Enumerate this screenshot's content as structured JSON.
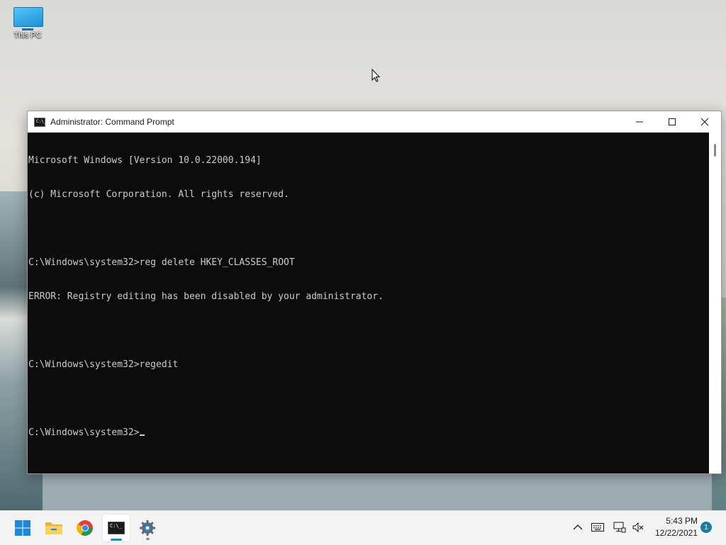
{
  "desktop": {
    "icons": [
      {
        "label": "This PC",
        "icon": "monitor-icon"
      }
    ]
  },
  "window": {
    "title": "Administrator: Command Prompt",
    "icon": "command-prompt-icon",
    "icon_glyph": "C:\\_",
    "controls": [
      "minimize-icon",
      "maximize-icon",
      "close-icon"
    ],
    "console_lines": [
      "Microsoft Windows [Version 10.0.22000.194]",
      "(c) Microsoft Corporation. All rights reserved.",
      "",
      "C:\\Windows\\system32>reg delete HKEY_CLASSES_ROOT",
      "ERROR: Registry editing has been disabled by your administrator.",
      "",
      "C:\\Windows\\system32>regedit",
      "",
      "C:\\Windows\\system32>"
    ],
    "colors": {
      "background": "#0c0c0c",
      "text": "#cccccc"
    }
  },
  "taskbar": {
    "apps": [
      {
        "name": "start",
        "icon": "windows-start-icon"
      },
      {
        "name": "file-explorer",
        "icon": "folder-icon"
      },
      {
        "name": "chrome",
        "icon": "chrome-icon"
      },
      {
        "name": "command-prompt",
        "icon": "terminal-icon",
        "active": true,
        "glyph": "C:\\_"
      },
      {
        "name": "settings",
        "icon": "gear-icon"
      }
    ],
    "tray": {
      "icons": [
        "chevron-up-icon",
        "keyboard-icon",
        "network-icon",
        "volume-muted-icon"
      ],
      "time": "5:43 PM",
      "date": "12/22/2021",
      "notification_count": "1"
    },
    "accent": "#1f8cae"
  }
}
